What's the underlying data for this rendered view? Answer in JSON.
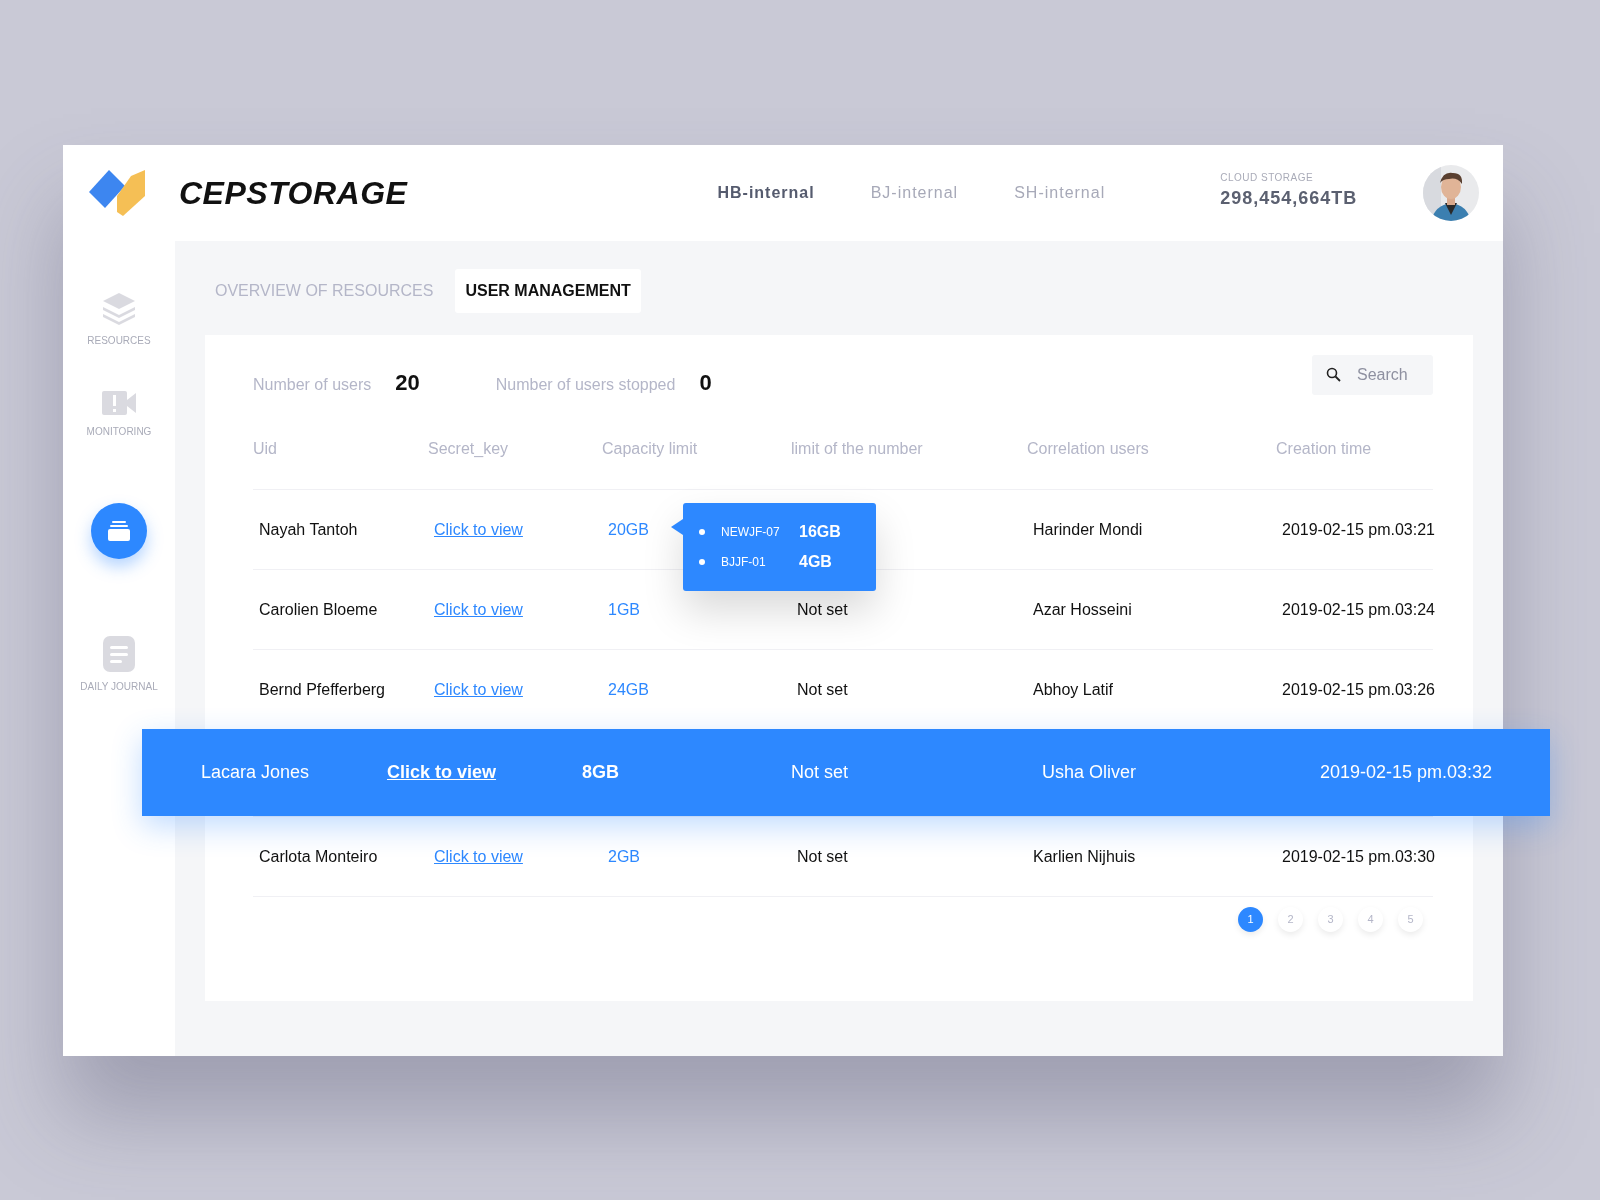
{
  "brand": {
    "name": "CEPSTORAGE"
  },
  "clusters": [
    {
      "label": "HB-internal",
      "selected": true
    },
    {
      "label": "BJ-internal",
      "selected": false
    },
    {
      "label": "SH-internal",
      "selected": false
    }
  ],
  "storage": {
    "label": "CLOUD STORAGE",
    "value": "298,454,664TB"
  },
  "sidebar": {
    "items": [
      {
        "kind": "layers",
        "label": "RESOURCES",
        "selected": false
      },
      {
        "kind": "camera",
        "label": "MONITORING",
        "selected": false
      },
      {
        "kind": "storage",
        "selected": true
      },
      {
        "kind": "journal",
        "label": "DAILY JOURNAL",
        "selected": false
      }
    ]
  },
  "tabs": [
    {
      "label": "OVERVIEW OF RESOURCES",
      "selected": false
    },
    {
      "label": "USER MANAGEMENT",
      "selected": true
    }
  ],
  "stats": [
    {
      "label": "Number of users",
      "value": "20"
    },
    {
      "label": "Number of users stopped",
      "value": "0"
    }
  ],
  "search": {
    "placeholder": "Search"
  },
  "table": {
    "columns": [
      "Uid",
      "Secret_key",
      "Capacity limit",
      "limit of the number",
      "Correlation users",
      "Creation time"
    ],
    "rows": [
      {
        "uid": "Nayah Tantoh",
        "secret_key": "Click to view",
        "capacity": "20GB",
        "correlation": "Harinder Mondi",
        "created": "2019-02-15 pm.03:21",
        "selected": false,
        "popover": [
          {
            "name": "NEWJF-07",
            "size": "16GB"
          },
          {
            "name": "BJJF-01",
            "size": "4GB"
          }
        ]
      },
      {
        "uid": "Carolien Bloeme",
        "secret_key": "Click to view",
        "capacity": "1GB",
        "limit": "Not set",
        "correlation": "Azar Hosseini",
        "created": "2019-02-15 pm.03:24",
        "selected": false
      },
      {
        "uid": "Bernd Pfefferberg",
        "secret_key": "Click to view",
        "capacity": "24GB",
        "limit": "Not set",
        "correlation": "Abhoy Latif",
        "created": "2019-02-15 pm.03:26",
        "selected": false
      },
      {
        "uid": "Lacara Jones",
        "secret_key": "Click to view",
        "capacity": "8GB",
        "limit": "Not set",
        "correlation": "Usha Oliver",
        "created": "2019-02-15 pm.03:32",
        "selected": true
      },
      {
        "uid": "Carlota Monteiro",
        "secret_key": "Click to view",
        "capacity": "2GB",
        "limit": "Not set",
        "correlation": "Karlien Nijhuis",
        "created": "2019-02-15 pm.03:30",
        "selected": false
      }
    ]
  },
  "pagination": [
    {
      "label": "1",
      "selected": true
    },
    {
      "label": "2",
      "selected": false
    },
    {
      "label": "3",
      "selected": false
    },
    {
      "label": "4",
      "selected": false
    },
    {
      "label": "5",
      "selected": false
    }
  ]
}
